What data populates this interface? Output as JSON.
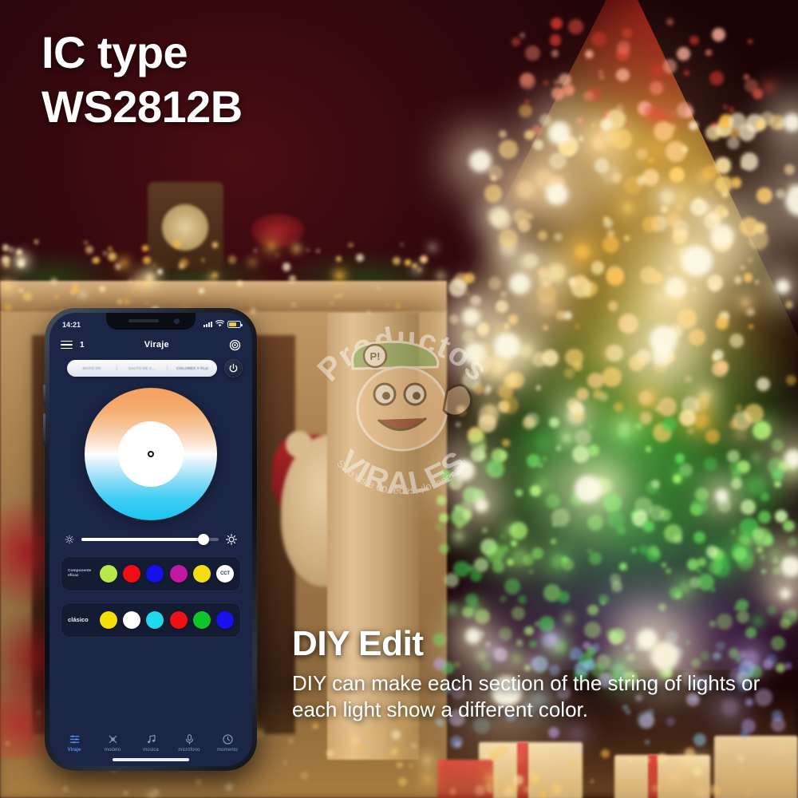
{
  "headline": {
    "line1": "IC type",
    "line2": "WS2812B"
  },
  "feature": {
    "title": "DIY Edit",
    "body": "DIY can make each section of the string of lights or each light show a different color."
  },
  "watermark": {
    "brand_top": "Productos",
    "brand_bottom": "VIRALES",
    "badge": "P!",
    "tagline": "Si lo viste en redes, ¡lo tenemos!"
  },
  "phone": {
    "statusbar": {
      "time": "14:21",
      "signal_icon": "cellular-signal-icon",
      "wifi_icon": "wifi-icon",
      "battery_icon": "battery-icon"
    },
    "appbar": {
      "menu_icon": "hamburger-menu-icon",
      "device_count": "1",
      "title": "Viraje",
      "settings_icon": "gear-icon"
    },
    "modes": {
      "segments": [
        {
          "label": "MATIZ DE",
          "active": false
        },
        {
          "label": "SALTO DE C...",
          "active": false
        },
        {
          "label": "COLORES Y FLU",
          "active": true
        }
      ],
      "power_icon": "power-icon"
    },
    "color_wheel": {
      "name": "cct-color-wheel",
      "top_color": "#f2a05f",
      "center_color": "#ffffff",
      "bottom_color": "#19c5f0",
      "knob_position": "center"
    },
    "brightness": {
      "low_icon": "brightness-low-icon",
      "high_icon": "brightness-high-icon",
      "value_percent": 89
    },
    "palettes": [
      {
        "label": "Componente eficaz",
        "name": "effective-component-palette",
        "swatches": [
          {
            "name": "yellow-green",
            "color": "#b6e84a"
          },
          {
            "name": "red",
            "color": "#ef0f13"
          },
          {
            "name": "blue",
            "color": "#1410e8"
          },
          {
            "name": "magenta",
            "color": "#c1189f"
          },
          {
            "name": "yellow",
            "color": "#f1dd12"
          },
          {
            "name": "cct",
            "color": "#ffffff",
            "text": "CCT"
          }
        ]
      },
      {
        "label": "clásico",
        "name": "classic-palette",
        "swatches": [
          {
            "name": "yellow",
            "color": "#f5de0b"
          },
          {
            "name": "white",
            "color": "#ffffff"
          },
          {
            "name": "cyan",
            "color": "#1fd9ec"
          },
          {
            "name": "red",
            "color": "#ee1014"
          },
          {
            "name": "green",
            "color": "#0fc628"
          },
          {
            "name": "blue",
            "color": "#1811ee"
          }
        ]
      }
    ],
    "tabs": [
      {
        "label": "Viraje",
        "icon": "sliders-icon",
        "active": true
      },
      {
        "label": "modelo",
        "icon": "pattern-icon",
        "active": false
      },
      {
        "label": "música",
        "icon": "music-note-icon",
        "active": false
      },
      {
        "label": "micrófono",
        "icon": "microphone-icon",
        "active": false
      },
      {
        "label": "momento",
        "icon": "clock-icon",
        "active": false
      }
    ],
    "accent_color": "#4f93ef",
    "screen_bg": "#1b2545"
  }
}
